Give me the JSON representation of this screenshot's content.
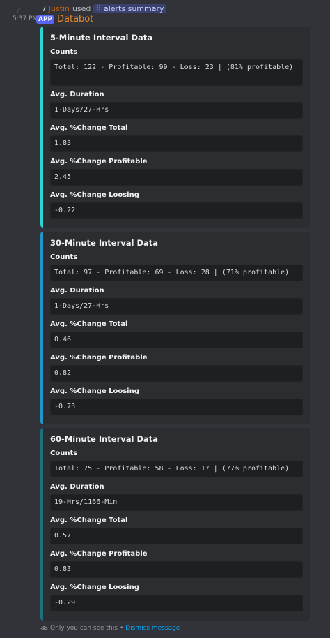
{
  "reply": {
    "user": "Justin",
    "used_text": "used",
    "command": "alerts summary"
  },
  "header": {
    "time": "5:37 PM",
    "badge": "APP",
    "bot_name": "Databot"
  },
  "embeds": [
    {
      "title": "5-Minute Interval Data",
      "accent": "#2fd6cf",
      "fields": [
        {
          "name": "Counts",
          "value": "Total: 122 - Profitable: 99 - Loss: 23 | (81% profitable)"
        },
        {
          "name": "Avg. Duration",
          "value": "1-Days/27-Hrs"
        },
        {
          "name": "Avg. %Change Total",
          "value": "1.83"
        },
        {
          "name": "Avg. %Change Profitable",
          "value": "2.45"
        },
        {
          "name": "Avg. %Change Loosing",
          "value": "-0.22"
        }
      ]
    },
    {
      "title": "30-Minute Interval Data",
      "accent": "#2196c9",
      "fields": [
        {
          "name": "Counts",
          "value": "Total: 97 - Profitable: 69 - Loss: 28 | (71% profitable)"
        },
        {
          "name": "Avg. Duration",
          "value": "1-Days/27-Hrs"
        },
        {
          "name": "Avg. %Change Total",
          "value": "0.46"
        },
        {
          "name": "Avg. %Change Profitable",
          "value": "0.82"
        },
        {
          "name": "Avg. %Change Loosing",
          "value": "-0.73"
        }
      ]
    },
    {
      "title": "60-Minute Interval Data",
      "accent": "#1f6f80",
      "fields": [
        {
          "name": "Counts",
          "value": "Total: 75 - Profitable: 58 - Loss: 17 | (77% profitable)"
        },
        {
          "name": "Avg. Duration",
          "value": "19-Hrs/1166-Min"
        },
        {
          "name": "Avg. %Change Total",
          "value": "0.57"
        },
        {
          "name": "Avg. %Change Profitable",
          "value": "0.83"
        },
        {
          "name": "Avg. %Change Loosing",
          "value": "-0.29"
        }
      ]
    }
  ],
  "footer": {
    "notice": "Only you can see this",
    "separator": "•",
    "dismiss": "Dismiss message"
  }
}
